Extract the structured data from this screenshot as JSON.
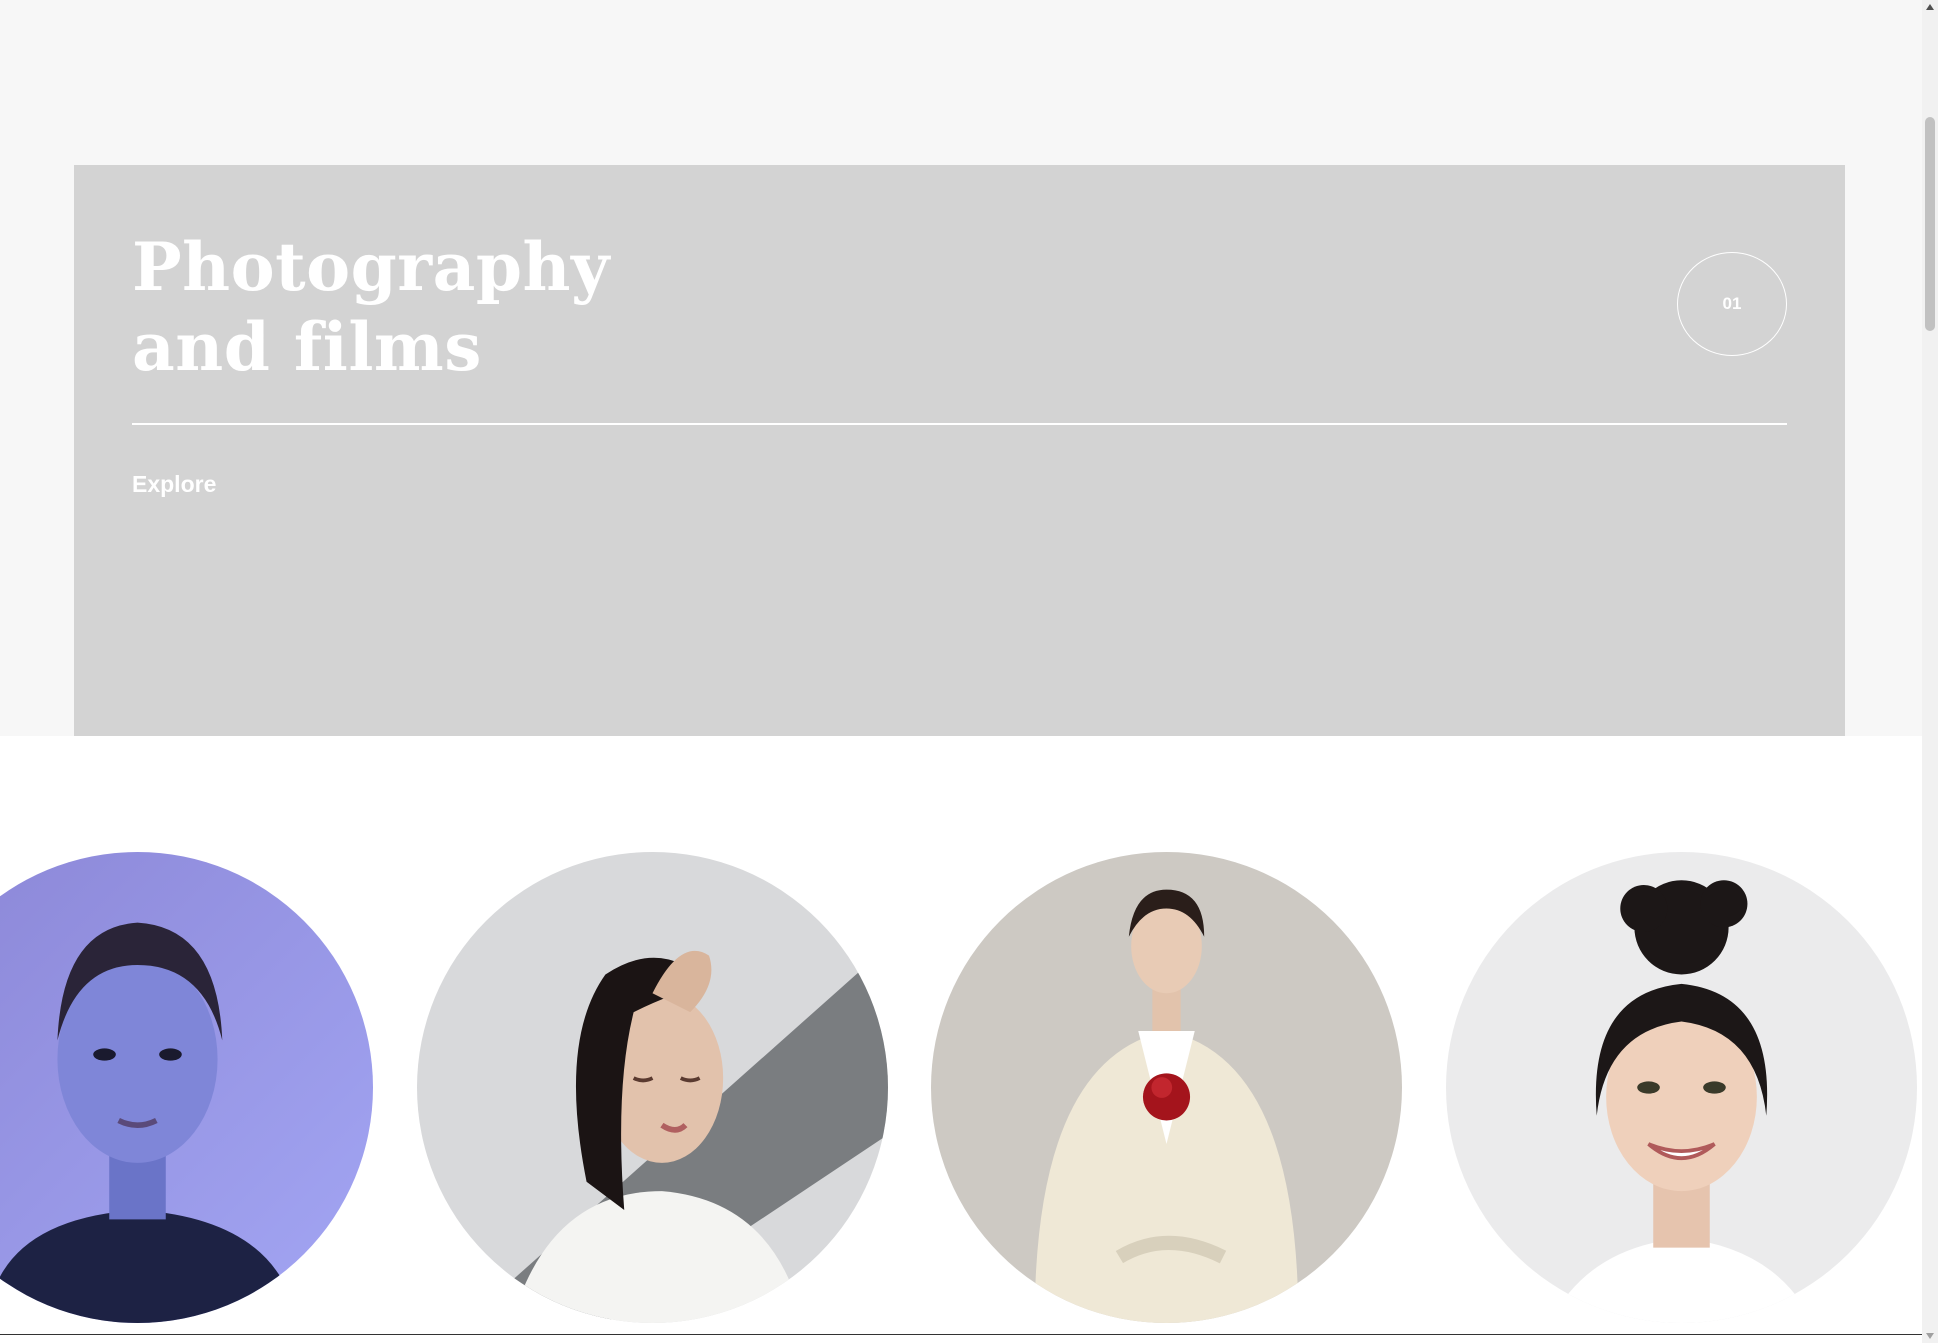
{
  "hero": {
    "title_line1": "Photography",
    "title_line2": "and films",
    "index": "01",
    "explore_label": "Explore"
  },
  "portraits": [
    {
      "name": "portrait-1",
      "background": "#9a98e6",
      "accent": "#2b3770"
    },
    {
      "name": "portrait-2",
      "background": "#d9dadc",
      "accent": "#1a1414"
    },
    {
      "name": "portrait-3",
      "background": "#cfcbc5",
      "accent": "#f2ecdc"
    },
    {
      "name": "portrait-4",
      "background": "#eceded",
      "accent": "#1b1616"
    }
  ],
  "colors": {
    "page_background": "#f7f7f7",
    "hero_background": "#d3d3d3",
    "hero_text": "#ffffff"
  }
}
